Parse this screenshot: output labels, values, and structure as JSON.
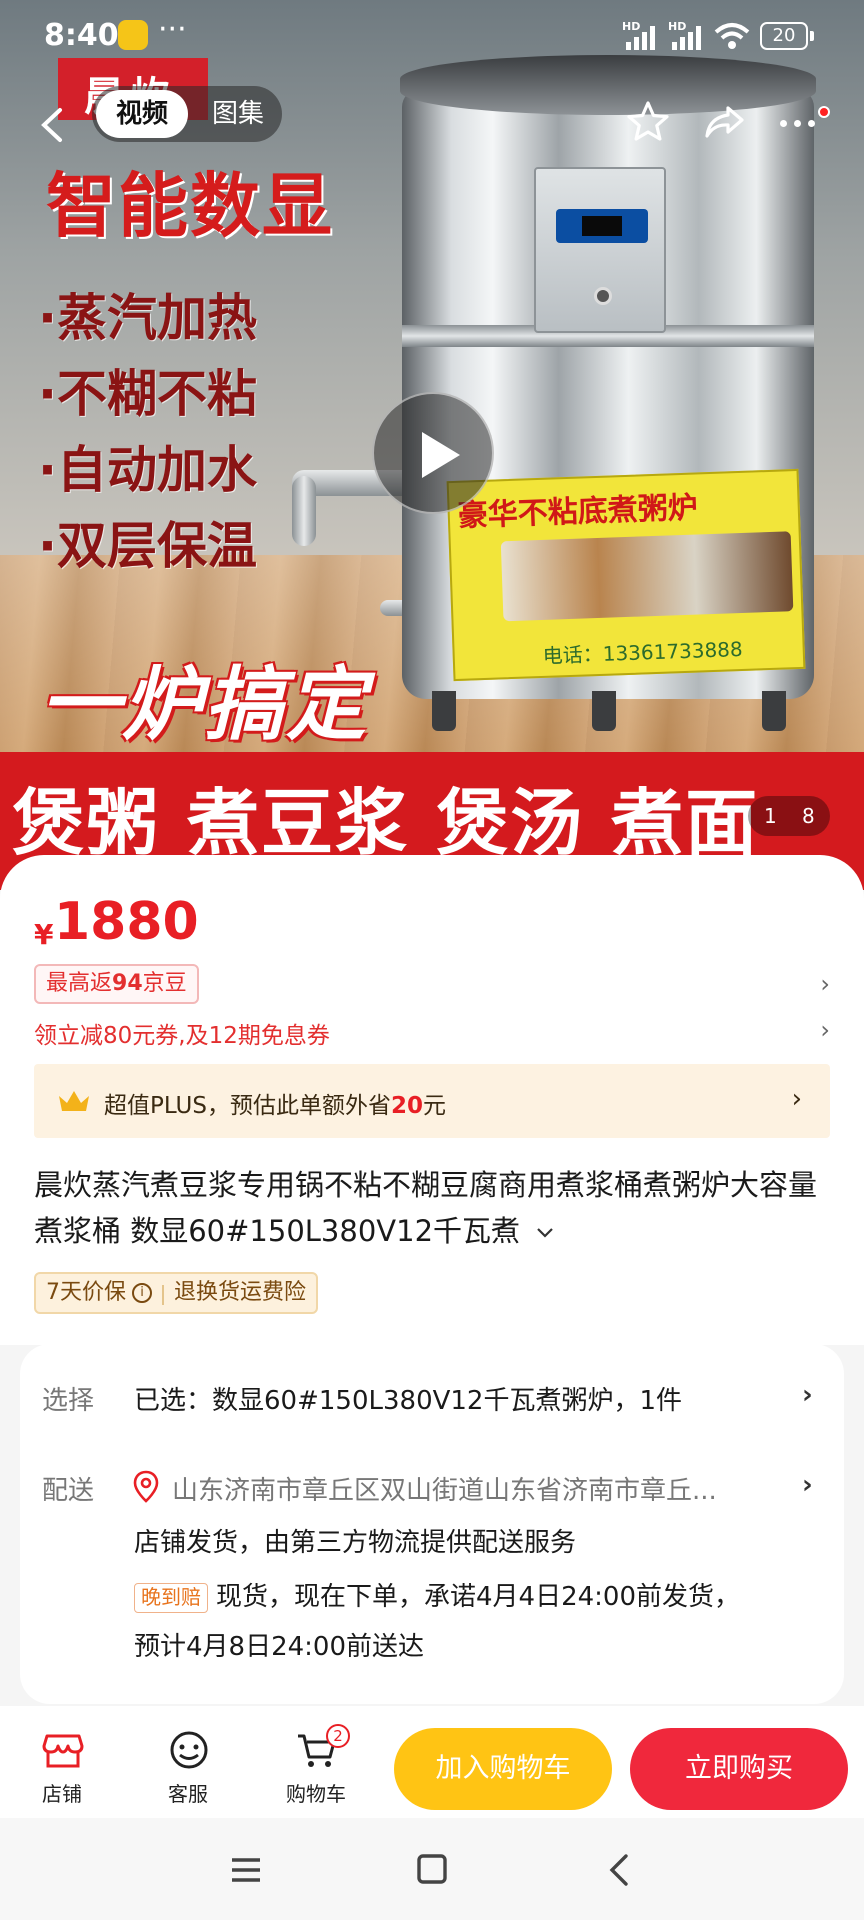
{
  "status_bar": {
    "time": "8:40",
    "more": "···",
    "network_1": "HD",
    "network_2": "HD",
    "battery": "20"
  },
  "top_nav": {
    "tab_video": "视频",
    "tab_gallery": "图集",
    "icons": [
      "back-icon",
      "favorite-star-icon",
      "share-icon",
      "more-icon"
    ]
  },
  "hero_image": {
    "brand": "晨炊",
    "headline": "智能数显",
    "features": [
      "·蒸汽加热",
      "·不糊不粘",
      "·自动加水",
      "·双层保温"
    ],
    "slogan": "一炉搞定",
    "bottom_band": "煲粥 煮豆浆 煲汤 煮面",
    "label_title": "豪华不粘底煮粥炉",
    "label_phone": "电话：13361733888",
    "pager_current": "1",
    "pager_total": "8"
  },
  "price": {
    "currency": "¥",
    "amount": "1880"
  },
  "promo": {
    "jd_beans_prefix": "最高返",
    "jd_beans_value": "94",
    "jd_beans_suffix": "京豆",
    "coupon": "领立减80元券,及12期免息券"
  },
  "plus": {
    "text_prefix": "超值PLUS，预估此单额外省",
    "amount": "20",
    "text_suffix": "元"
  },
  "product": {
    "title": "晨炊蒸汽煮豆浆专用锅不粘不糊豆腐商用煮浆桶煮粥炉大容量煮浆桶 数显60#150L380V12千瓦煮",
    "tag_price_protect": "7天价保",
    "tag_return_insurance": "退换货运费险"
  },
  "details": {
    "select_label": "选择",
    "select_value": "已选：数显60#150L380V12千瓦煮粥炉，1件",
    "delivery_label": "配送",
    "address": "山东济南市章丘区双山街道山东省济南市章丘...",
    "ship_info": "店铺发货，由第三方物流提供配送服务",
    "late_tag": "晚到赔",
    "ship_promise": "现货，现在下单，承诺4月4日24:00前发货，",
    "eta": "预计4月8日24:00前送达"
  },
  "action_bar": {
    "store": "店铺",
    "service": "客服",
    "cart": "购物车",
    "cart_count": "2",
    "add_to_cart": "加入购物车",
    "buy_now": "立即购买"
  },
  "colors": {
    "price_red": "#e81f25",
    "cart_yellow": "#ffc414",
    "buy_red": "#f0283c",
    "plus_bg": "#fdf2e1"
  }
}
